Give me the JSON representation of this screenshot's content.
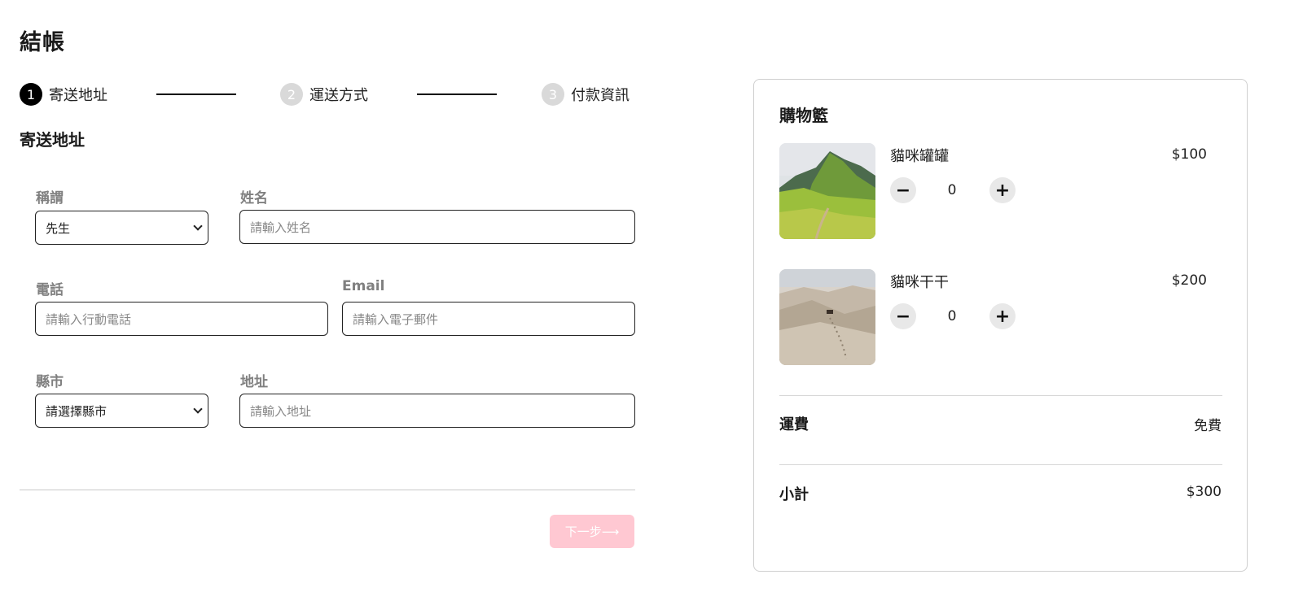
{
  "page": {
    "title": "結帳"
  },
  "stepper": {
    "steps": [
      {
        "num": "1",
        "label": "寄送地址"
      },
      {
        "num": "2",
        "label": "運送方式"
      },
      {
        "num": "3",
        "label": "付款資訊"
      }
    ],
    "active_step": 1
  },
  "form": {
    "section_title": "寄送地址",
    "salutation": {
      "label": "稱謂",
      "value": "先生"
    },
    "name": {
      "label": "姓名",
      "placeholder": "請輸入姓名"
    },
    "phone": {
      "label": "電話",
      "placeholder": "請輸入行動電話"
    },
    "email": {
      "label": "Email",
      "placeholder": "請輸入電子郵件"
    },
    "city": {
      "label": "縣市",
      "value": "請選擇縣市"
    },
    "address": {
      "label": "地址",
      "placeholder": "請輸入地址"
    },
    "next_label": "下一步⟶"
  },
  "cart": {
    "title": "購物籃",
    "items": [
      {
        "name": "貓咪罐罐",
        "price": "$100",
        "qty": "0",
        "thumb": "mountain-landscape-image"
      },
      {
        "name": "貓咪干干",
        "price": "$200",
        "qty": "0",
        "thumb": "desert-dunes-image"
      }
    ],
    "minus_symbol": "−",
    "plus_symbol": "+",
    "shipping": {
      "label": "運費",
      "value": "免費"
    },
    "subtotal": {
      "label": "小計",
      "value": "$300"
    }
  },
  "colors": {
    "accent_pink": "#ffc8d2",
    "step_active": "#000000",
    "step_inactive": "#d9d9d9",
    "label_gray": "#808080"
  }
}
